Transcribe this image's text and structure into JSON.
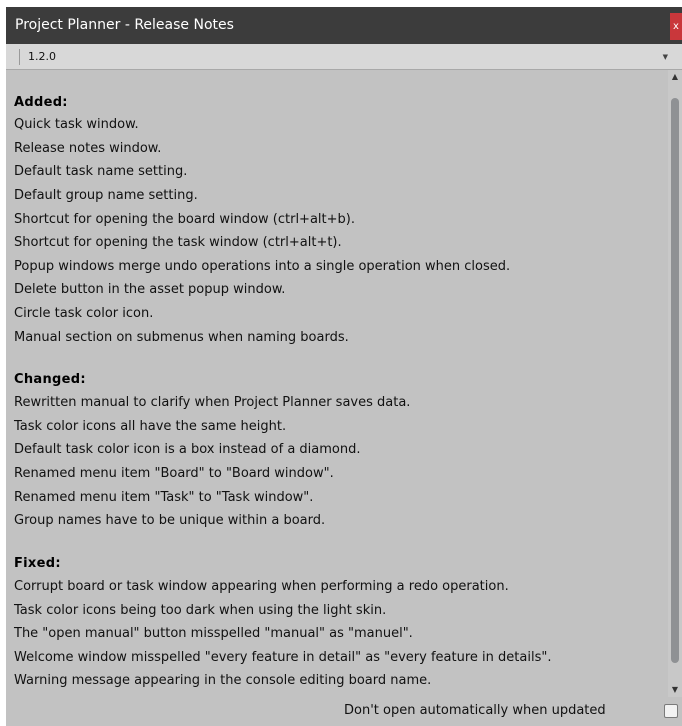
{
  "window": {
    "title": "Project Planner - Release Notes",
    "close_label": "x"
  },
  "toolbar": {
    "version": "1.2.0",
    "arrow_icon": "dropdown-arrow-icon"
  },
  "sections": [
    {
      "title": "Added:",
      "items": [
        "Quick task window.",
        "Release notes window.",
        "Default task name setting.",
        "Default group name setting.",
        "Shortcut for opening the board window (ctrl+alt+b).",
        "Shortcut for opening the task window (ctrl+alt+t).",
        "Popup windows merge undo operations into a single operation when closed.",
        "Delete button in the asset popup window.",
        "Circle task color icon.",
        "Manual section on submenus when naming boards."
      ]
    },
    {
      "title": "Changed:",
      "items": [
        "Rewritten manual to clarify when Project Planner saves data.",
        "Task color icons all have the same height.",
        "Default task color icon is a box instead of a diamond.",
        "Renamed menu item \"Board\" to \"Board window\".",
        "Renamed menu item \"Task\" to \"Task window\".",
        "Group names have to be unique within a board."
      ]
    },
    {
      "title": "Fixed:",
      "items": [
        "Corrupt board or task window appearing when performing a redo operation.",
        "Task color icons being too dark when using the light skin.",
        "The \"open manual\" button misspelled \"manual\" as \"manuel\".",
        "Welcome window misspelled \"every feature in detail\" as \"every feature in details\".",
        "Warning message appearing in the console editing board name."
      ]
    }
  ],
  "footer": {
    "checkbox_label": "Don't open automatically when updated",
    "checked": false
  },
  "colors": {
    "titlebar": "#3c3c3c",
    "close": "#c9373b",
    "panel": "#c2c2c2",
    "scroll_thumb": "#8f9194"
  }
}
